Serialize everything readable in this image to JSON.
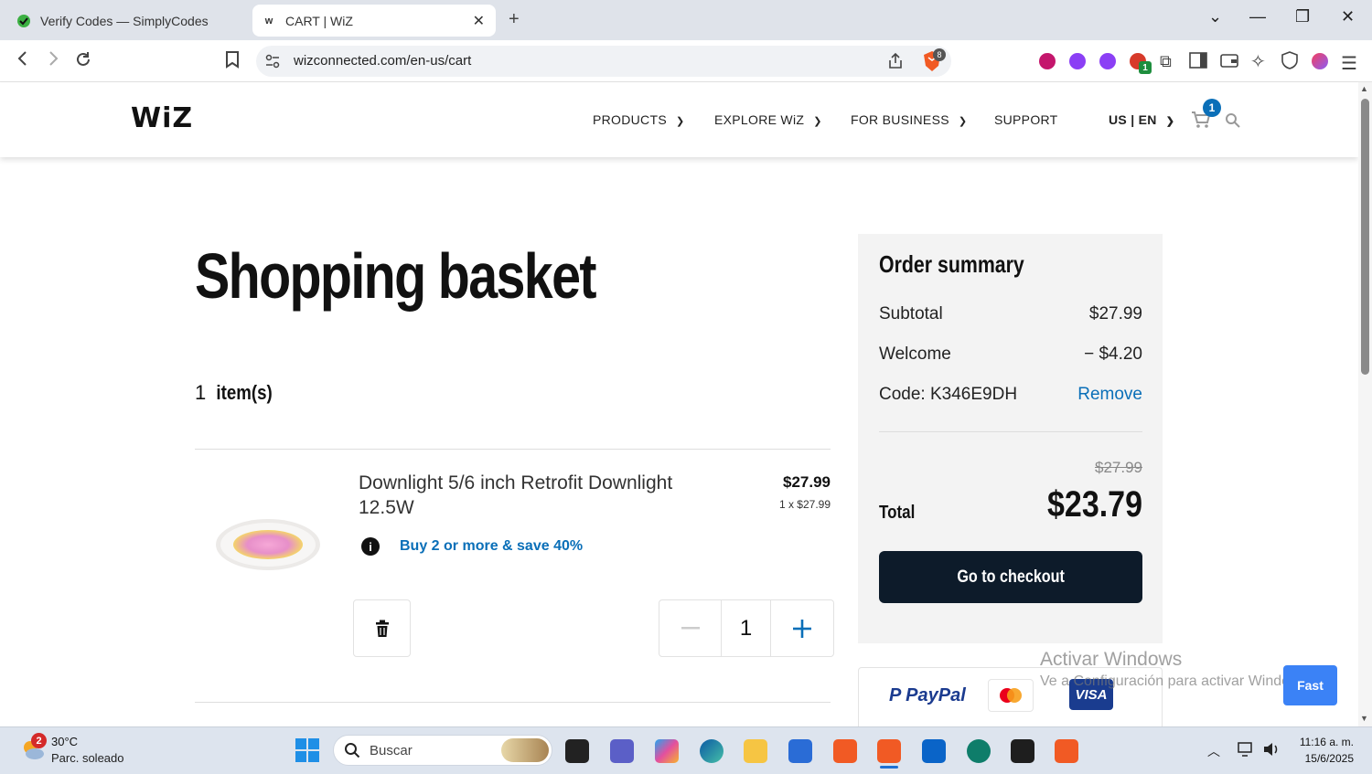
{
  "browser": {
    "tabs": [
      {
        "title": "Verify Codes — SimplyCodes",
        "active": false
      },
      {
        "title": "CART | WiZ",
        "active": true
      }
    ],
    "url": "wizconnected.com/en-us/cart",
    "brave_badge": "8",
    "ext_badge": "1"
  },
  "site": {
    "logo": "WiZ",
    "menu": [
      "PRODUCTS",
      "EXPLORE WiZ",
      "FOR BUSINESS",
      "SUPPORT"
    ],
    "locale": "US | EN",
    "cart_count": "1"
  },
  "cart": {
    "title": "Shopping basket",
    "count_num": "1",
    "count_label": "item(s)",
    "item": {
      "name": "Downlight 5/6 inch Retrofit Downlight 12.5W",
      "price": "$27.99",
      "unit_price": "1 x $27.99",
      "promo": "Buy 2 or more & save 40%",
      "quantity": "1"
    }
  },
  "summary": {
    "title": "Order summary",
    "subtotal_label": "Subtotal",
    "subtotal_value": "$27.99",
    "discount_label": "Welcome",
    "discount_value": "− $4.20",
    "code_label": "Code: K346E9DH",
    "remove_label": "Remove",
    "old_total": "$27.99",
    "total_label": "Total",
    "total_value": "$23.79",
    "checkout_label": "Go to checkout",
    "payment": [
      "PayPal",
      "VISA"
    ]
  },
  "overlay": {
    "watermark_title": "Activar Windows",
    "watermark_sub": "Ve a Configuración para activar Windows.",
    "fast_button": "Fast"
  },
  "taskbar": {
    "weather_badge": "2",
    "temp": "30°C",
    "weather": "Parc. soleado",
    "search_placeholder": "Buscar",
    "time": "11:16 a. m.",
    "date": "15/6/2025"
  }
}
